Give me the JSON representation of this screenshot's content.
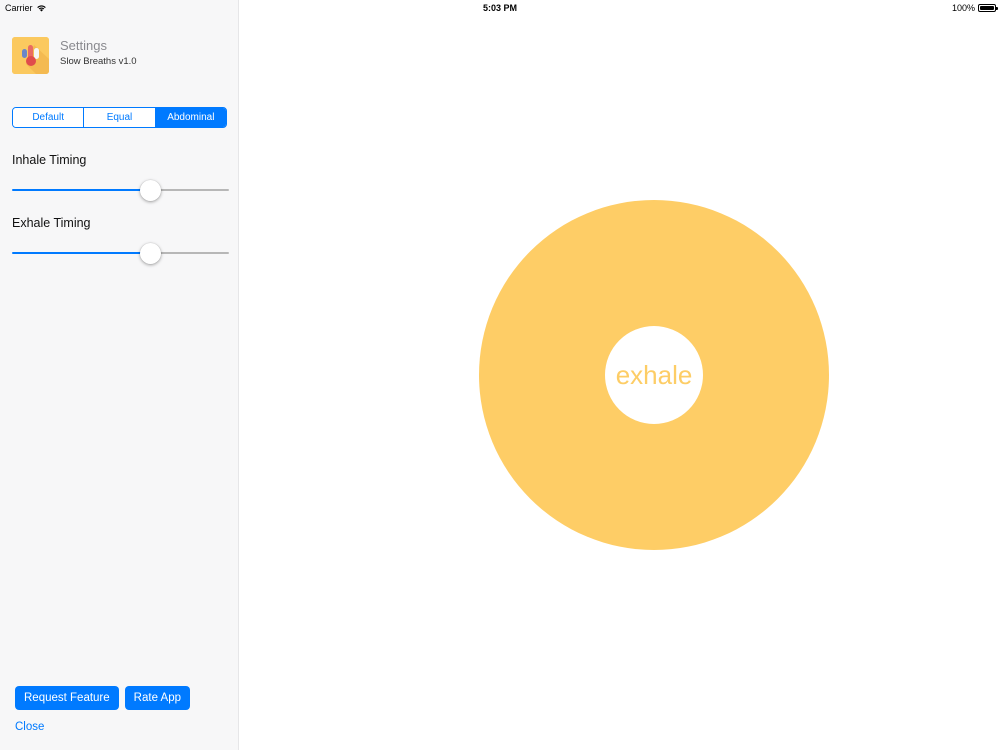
{
  "status_bar": {
    "carrier": "Carrier",
    "time": "5:03 PM",
    "battery": "100%"
  },
  "sidebar": {
    "app_title": "Settings",
    "app_subtitle": "Slow Breaths v1.0",
    "modes": [
      {
        "label": "Default",
        "selected": false
      },
      {
        "label": "Equal",
        "selected": false
      },
      {
        "label": "Abdominal",
        "selected": true
      }
    ],
    "inhale": {
      "label": "Inhale Timing",
      "value": 0.65
    },
    "exhale": {
      "label": "Exhale Timing",
      "value": 0.65
    },
    "request_feature_label": "Request Feature",
    "rate_app_label": "Rate App",
    "close_label": "Close"
  },
  "main": {
    "phase": "exhale"
  },
  "colors": {
    "accent": "#007aff",
    "circle": "#fecd66",
    "phase_text": "#fdcd66",
    "track_max": "#b7b7b7"
  },
  "icons": {
    "wifi": "wifi-icon",
    "battery": "battery-icon",
    "app": "app-icon"
  }
}
